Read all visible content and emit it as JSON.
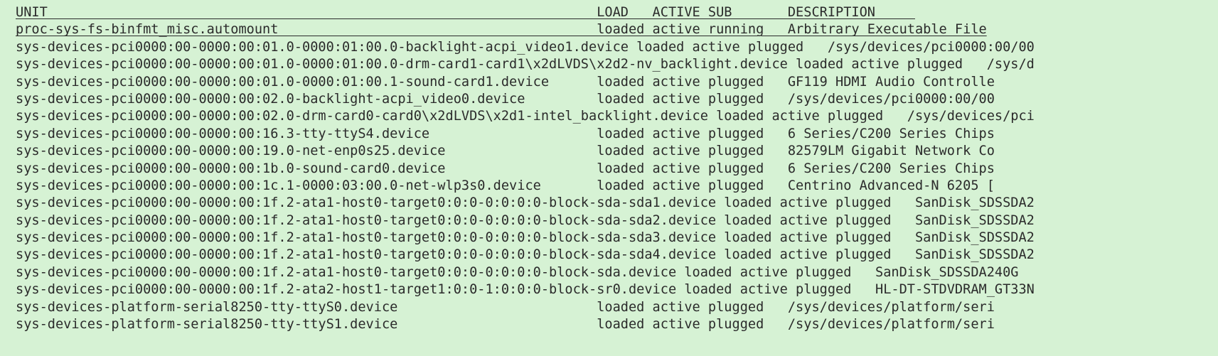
{
  "terminal": {
    "background": "#d6f2d4",
    "foreground": "#2b2b2b",
    "lines": [
      "UNIT                                                                     LOAD   ACTIVE SUB       DESCRIPTION     ",
      "proc-sys-fs-binfmt_misc.automount                                        loaded active running   Arbitrary Executable File",
      "sys-devices-pci0000:00-0000:00:01.0-0000:01:00.0-backlight-acpi_video1.device loaded active plugged   /sys/devices/pci0000:00/00",
      "sys-devices-pci0000:00-0000:00:01.0-0000:01:00.0-drm-card1-card1\\x2dLVDS\\x2d2-nv_backlight.device loaded active plugged   /sys/d",
      "sys-devices-pci0000:00-0000:00:01.0-0000:01:00.1-sound-card1.device      loaded active plugged   GF119 HDMI Audio Controlle",
      "sys-devices-pci0000:00-0000:00:02.0-backlight-acpi_video0.device         loaded active plugged   /sys/devices/pci0000:00/00",
      "sys-devices-pci0000:00-0000:00:02.0-drm-card0-card0\\x2dLVDS\\x2d1-intel_backlight.device loaded active plugged   /sys/devices/pci",
      "sys-devices-pci0000:00-0000:00:16.3-tty-ttyS4.device                     loaded active plugged   6 Series/C200 Series Chips",
      "sys-devices-pci0000:00-0000:00:19.0-net-enp0s25.device                   loaded active plugged   82579LM Gigabit Network Co",
      "sys-devices-pci0000:00-0000:00:1b.0-sound-card0.device                   loaded active plugged   6 Series/C200 Series Chips",
      "sys-devices-pci0000:00-0000:00:1c.1-0000:03:00.0-net-wlp3s0.device       loaded active plugged   Centrino Advanced-N 6205 [",
      "sys-devices-pci0000:00-0000:00:1f.2-ata1-host0-target0:0:0-0:0:0:0-block-sda-sda1.device loaded active plugged   SanDisk_SDSSDA2",
      "sys-devices-pci0000:00-0000:00:1f.2-ata1-host0-target0:0:0-0:0:0:0-block-sda-sda2.device loaded active plugged   SanDisk_SDSSDA2",
      "sys-devices-pci0000:00-0000:00:1f.2-ata1-host0-target0:0:0-0:0:0:0-block-sda-sda3.device loaded active plugged   SanDisk_SDSSDA2",
      "sys-devices-pci0000:00-0000:00:1f.2-ata1-host0-target0:0:0-0:0:0:0-block-sda-sda4.device loaded active plugged   SanDisk_SDSSDA2",
      "sys-devices-pci0000:00-0000:00:1f.2-ata1-host0-target0:0:0-0:0:0:0-block-sda.device loaded active plugged   SanDisk_SDSSDA240G",
      "sys-devices-pci0000:00-0000:00:1f.2-ata2-host1-target1:0:0-1:0:0:0-block-sr0.device loaded active plugged   HL-DT-STDVDRAM_GT33N",
      "sys-devices-platform-serial8250-tty-ttyS0.device                         loaded active plugged   /sys/devices/platform/seri",
      "sys-devices-platform-serial8250-tty-ttyS1.device                         loaded active plugged   /sys/devices/platform/seri"
    ]
  }
}
